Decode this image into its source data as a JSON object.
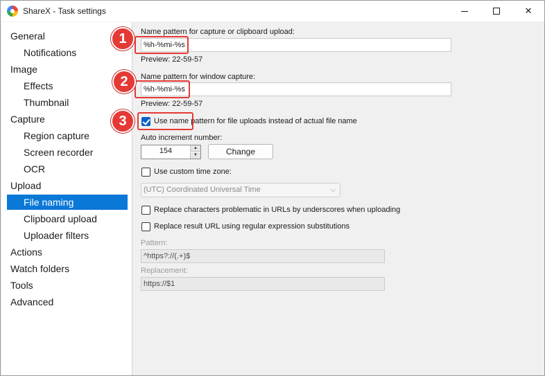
{
  "window": {
    "title": "ShareX - Task settings"
  },
  "sidebar": {
    "items": [
      {
        "label": "General",
        "level": 0
      },
      {
        "label": "Notifications",
        "level": 1
      },
      {
        "label": "Image",
        "level": 0
      },
      {
        "label": "Effects",
        "level": 1
      },
      {
        "label": "Thumbnail",
        "level": 1
      },
      {
        "label": "Capture",
        "level": 0
      },
      {
        "label": "Region capture",
        "level": 1
      },
      {
        "label": "Screen recorder",
        "level": 1
      },
      {
        "label": "OCR",
        "level": 1
      },
      {
        "label": "Upload",
        "level": 0
      },
      {
        "label": "File naming",
        "level": 1,
        "selected": true
      },
      {
        "label": "Clipboard upload",
        "level": 1
      },
      {
        "label": "Uploader filters",
        "level": 1
      },
      {
        "label": "Actions",
        "level": 0
      },
      {
        "label": "Watch folders",
        "level": 0
      },
      {
        "label": "Tools",
        "level": 0
      },
      {
        "label": "Advanced",
        "level": 0
      }
    ]
  },
  "file_naming": {
    "capture_pattern_label": "Name pattern for capture or clipboard upload:",
    "capture_pattern_value": "%h-%mi-%s",
    "capture_preview": "Preview: 22-59-57",
    "window_pattern_label": "Name pattern for window capture:",
    "window_pattern_value": "%h-%mi-%s",
    "window_preview": "Preview: 22-59-57",
    "use_name_pattern_label": "Use name pattern for file uploads instead of actual file name",
    "use_name_pattern_checked": true,
    "auto_increment_label": "Auto increment number:",
    "auto_increment_value": "154",
    "change_button": "Change",
    "custom_time_zone_label": "Use custom time zone:",
    "custom_time_zone_checked": false,
    "time_zone_value": "(UTC) Coordinated Universal Time",
    "replace_chars_label": "Replace characters problematic in URLs by underscores when uploading",
    "replace_chars_checked": false,
    "replace_regex_label": "Replace result URL using regular expression substitutions",
    "replace_regex_checked": false,
    "pattern_label": "Pattern:",
    "pattern_value": "^https?://(.+)$",
    "replacement_label": "Replacement:",
    "replacement_value": "https://$1"
  },
  "annotations": [
    "1",
    "2",
    "3"
  ],
  "colors": {
    "selection": "#0a78d7",
    "annotation": "#e53935",
    "checkbox": "#0a62c7"
  }
}
